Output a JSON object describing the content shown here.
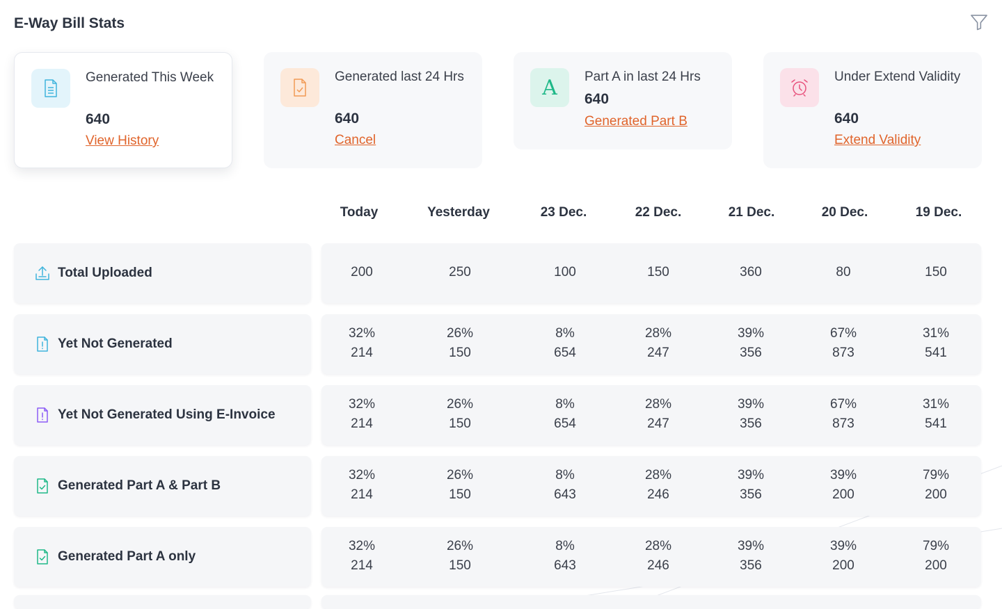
{
  "header": {
    "title": "E-Way Bill Stats",
    "filter_icon": "filter-icon"
  },
  "cards": [
    {
      "icon": "document-icon",
      "icon_color": "#3fb4dc",
      "icon_bg": "#e3f4fb",
      "label": "Generated This Week",
      "value": "640",
      "link": "View History"
    },
    {
      "icon": "file-check-icon",
      "icon_color": "#f29a54",
      "icon_bg": "#fde9da",
      "label": "Generated last 24 Hrs",
      "value": "640",
      "link": "Cancel"
    },
    {
      "icon": "letter-a-icon",
      "icon_glyph": "A",
      "icon_color": "#1fb888",
      "icon_bg": "#dcf4ec",
      "label": "Part A in last 24 Hrs",
      "value": "640",
      "link": "Generated Part B"
    },
    {
      "icon": "alarm-clock-icon",
      "icon_color": "#e8537d",
      "icon_bg": "#fbe1e9",
      "label": "Under Extend Validity",
      "value": "640",
      "link": "Extend Validity"
    }
  ],
  "columns": [
    "Today",
    "Yesterday",
    "23 Dec.",
    "22 Dec.",
    "21 Dec.",
    "20 Dec.",
    "19 Dec."
  ],
  "rows": [
    {
      "icon": "upload-icon",
      "icon_color": "#3fb4dc",
      "label": "Total Uploaded",
      "cells": [
        {
          "count": "200"
        },
        {
          "count": "250"
        },
        {
          "count": "100"
        },
        {
          "count": "150"
        },
        {
          "count": "360"
        },
        {
          "count": "80"
        },
        {
          "count": "150"
        }
      ]
    },
    {
      "icon": "file-alert-icon",
      "icon_color": "#3fb4dc",
      "label": "Yet Not Generated",
      "cells": [
        {
          "pct": "32%",
          "count": "214"
        },
        {
          "pct": "26%",
          "count": "150"
        },
        {
          "pct": "8%",
          "count": "654"
        },
        {
          "pct": "28%",
          "count": "247"
        },
        {
          "pct": "39%",
          "count": "356"
        },
        {
          "pct": "67%",
          "count": "873"
        },
        {
          "pct": "31%",
          "count": "541"
        }
      ]
    },
    {
      "icon": "file-alert-icon",
      "icon_color": "#8b5cf6",
      "label": "Yet Not Generated Using E-Invoice",
      "cells": [
        {
          "pct": "32%",
          "count": "214"
        },
        {
          "pct": "26%",
          "count": "150"
        },
        {
          "pct": "8%",
          "count": "654"
        },
        {
          "pct": "28%",
          "count": "247"
        },
        {
          "pct": "39%",
          "count": "356"
        },
        {
          "pct": "67%",
          "count": "873"
        },
        {
          "pct": "31%",
          "count": "541"
        }
      ]
    },
    {
      "icon": "file-check-icon",
      "icon_color": "#1fb888",
      "label": "Generated Part A & Part B",
      "cells": [
        {
          "pct": "32%",
          "count": "214"
        },
        {
          "pct": "26%",
          "count": "150"
        },
        {
          "pct": "8%",
          "count": "643"
        },
        {
          "pct": "28%",
          "count": "246"
        },
        {
          "pct": "39%",
          "count": "356"
        },
        {
          "pct": "39%",
          "count": "200"
        },
        {
          "pct": "79%",
          "count": "200"
        }
      ]
    },
    {
      "icon": "file-check-icon",
      "icon_color": "#1fb888",
      "label": "Generated Part A only",
      "cells": [
        {
          "pct": "32%",
          "count": "214"
        },
        {
          "pct": "26%",
          "count": "150"
        },
        {
          "pct": "8%",
          "count": "643"
        },
        {
          "pct": "28%",
          "count": "246"
        },
        {
          "pct": "39%",
          "count": "356"
        },
        {
          "pct": "39%",
          "count": "200"
        },
        {
          "pct": "79%",
          "count": "200"
        }
      ]
    }
  ]
}
